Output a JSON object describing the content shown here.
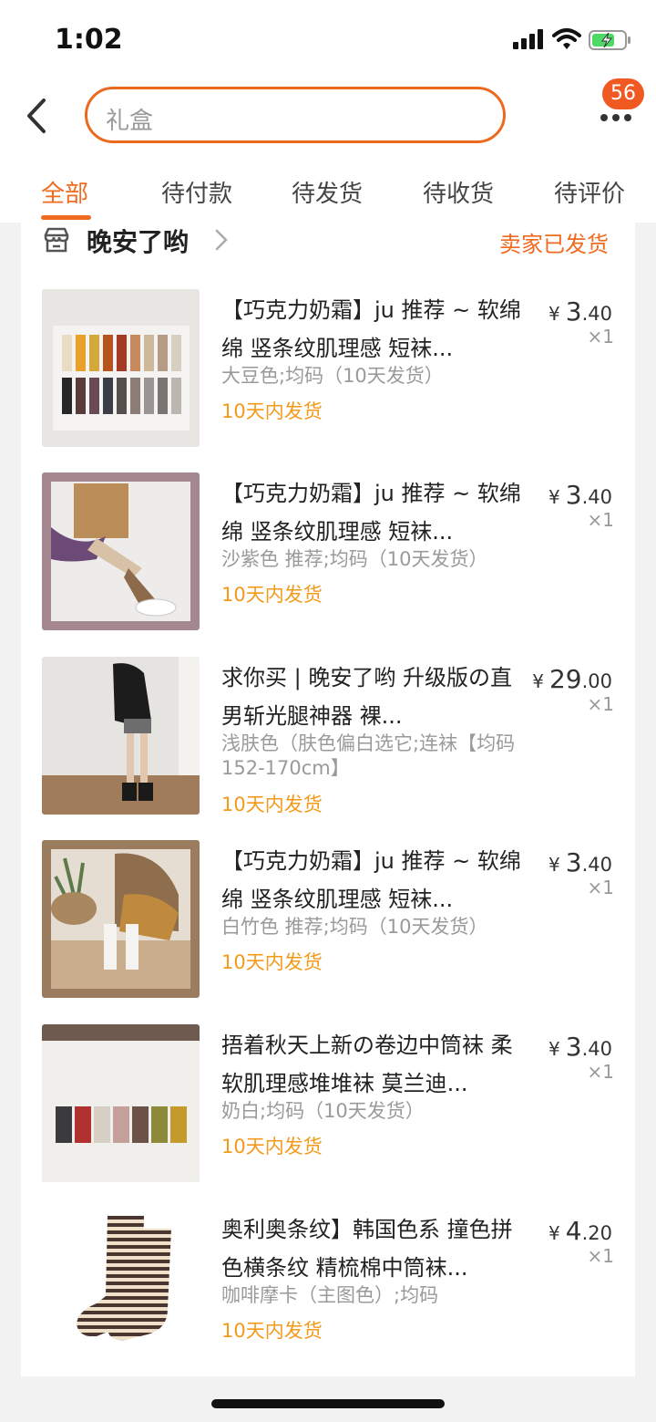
{
  "status": {
    "time": "1:02"
  },
  "search": {
    "placeholder": "礼盒"
  },
  "header": {
    "badge": "56"
  },
  "tabs": [
    "全部",
    "待付款",
    "待发货",
    "待收货",
    "待评价"
  ],
  "shop": {
    "name": "晚安了哟",
    "status": "卖家已发货"
  },
  "items": [
    {
      "title": "【巧克力奶霜】ju 推荐 ~ 软绵绵 竖条纹肌理感 短袜...",
      "sku": "大豆色;均码（10天发货）",
      "shipping": "10天内发货",
      "price_int": "3",
      "price_dec": ".40",
      "currency": "¥",
      "qty": "×1"
    },
    {
      "title": "【巧克力奶霜】ju 推荐 ~ 软绵绵 竖条纹肌理感 短袜...",
      "sku": "沙紫色 推荐;均码（10天发货）",
      "shipping": "10天内发货",
      "price_int": "3",
      "price_dec": ".40",
      "currency": "¥",
      "qty": "×1"
    },
    {
      "title": "求你买 | 晚安了哟 升级版の直男斩光腿神器 裸...",
      "sku": "浅肤色（肤色偏白选它;连袜【均码152-170cm】",
      "shipping": "10天内发货",
      "price_int": "29",
      "price_dec": ".00",
      "currency": "¥",
      "qty": "×1"
    },
    {
      "title": "【巧克力奶霜】ju 推荐 ~ 软绵绵 竖条纹肌理感 短袜...",
      "sku": "白竹色 推荐;均码（10天发货）",
      "shipping": "10天内发货",
      "price_int": "3",
      "price_dec": ".40",
      "currency": "¥",
      "qty": "×1"
    },
    {
      "title": "捂着秋天上新の卷边中筒袜 柔软肌理感堆堆袜 莫兰迪...",
      "sku": "奶白;均码（10天发货）",
      "shipping": "10天内发货",
      "price_int": "3",
      "price_dec": ".40",
      "currency": "¥",
      "qty": "×1"
    },
    {
      "title": "奥利奥条纹】韩国色系 撞色拼色横条纹 精梳棉中筒袜...",
      "sku": "咖啡摩卡（主图色）;均码",
      "shipping": "10天内发货",
      "price_int": "4",
      "price_dec": ".20",
      "currency": "¥",
      "qty": "×1"
    }
  ]
}
